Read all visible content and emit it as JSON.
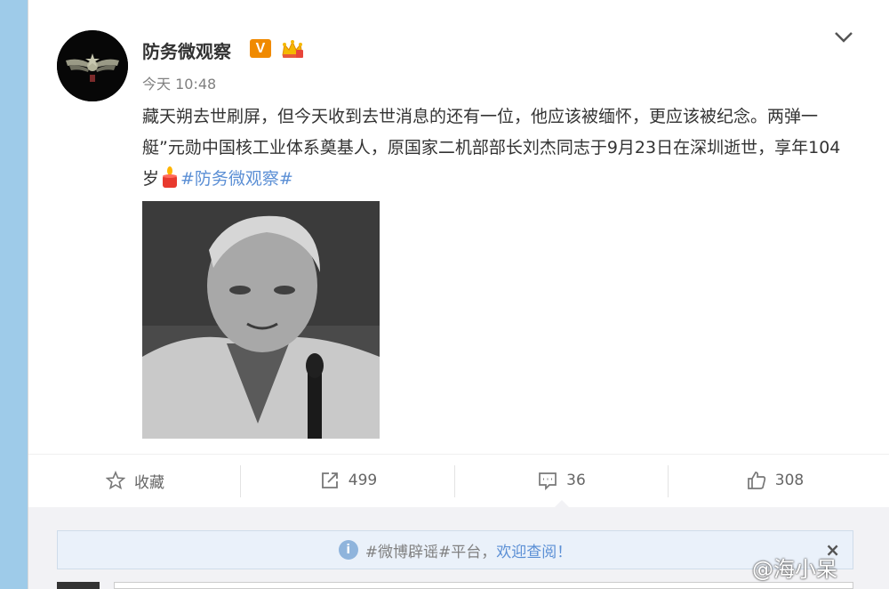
{
  "post": {
    "author": "防务微观察",
    "verified_badge": "V",
    "timestamp": "今天 10:48",
    "content": {
      "line1": "藏天朔去世刷屏，但今天收到去世消息的还有一位，他应该被缅怀，更应该被纪念。两弹一艇”元勋中国核工业体系奠基人，原国家二机部部长刘杰同志于9月23日在深圳逝世，享年104岁",
      "topic": "#防务微观察#"
    },
    "photo_alt": "portrait-photo"
  },
  "actions": {
    "favorite_label": "收藏",
    "repost_count": "499",
    "comment_count": "36",
    "like_count": "308"
  },
  "notice": {
    "info_glyph": "i",
    "prefix": "#微博辟谣#平台，",
    "link": "欢迎查阅！",
    "close_glyph": "×"
  },
  "watermark": "@海小呆",
  "colors": {
    "background": "#9ecbe9",
    "link": "#5b8fd5",
    "badge": "#f08a00"
  }
}
